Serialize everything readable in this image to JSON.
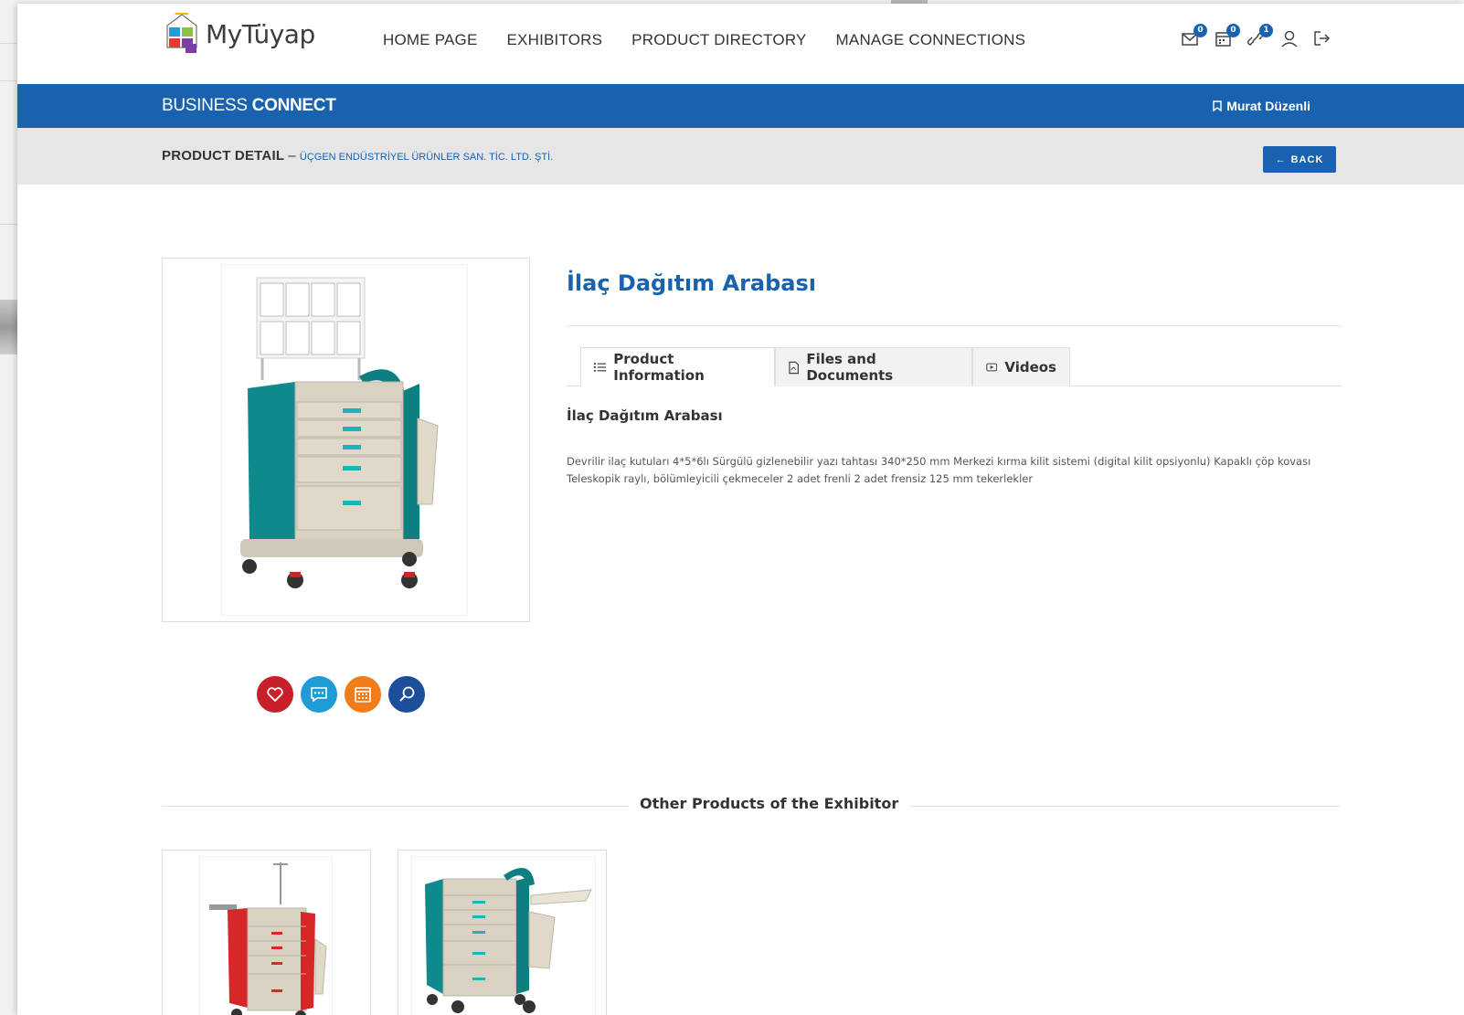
{
  "nav": {
    "logo_text": "MyTüyap",
    "menu": [
      {
        "label": "HOME PAGE"
      },
      {
        "label": "EXHIBITORS"
      },
      {
        "label": "PRODUCT DIRECTORY"
      },
      {
        "label": "MANAGE CONNECTIONS"
      }
    ],
    "badges": {
      "messages": "0",
      "calendar": "0",
      "connections": "1"
    }
  },
  "business_bar": {
    "title_light": "BUSINESS ",
    "title_bold": "CONNECT",
    "user_name": "Murat Düzenli"
  },
  "detail_bar": {
    "label": "PRODUCT DETAIL",
    "separator": " – ",
    "company": "ÜÇGEN ENDÜSTRİYEL ÜRÜNLER SAN. TİC. LTD. ŞTİ.",
    "back_label": "BACK"
  },
  "product": {
    "title": "İlaç Dağıtım Arabası",
    "tabs": [
      {
        "label": "Product Information",
        "icon": "list-icon",
        "active": true
      },
      {
        "label": "Files and Documents",
        "icon": "pdf-file-icon",
        "active": false
      },
      {
        "label": "Videos",
        "icon": "video-icon",
        "active": false
      }
    ],
    "subheading": "İlaç Dağıtım Arabası",
    "description": "Devrilir ilaç kutuları 4*5*6lı Sürgülü gizlenebilir yazı tahtası 340*250 mm Merkezi kırma kilit sistemi (digital kilit opsiyonlu) Kapaklı çöp kovası Teleskopik raylı, bölümleyicili çekmeceler 2 adet frenli 2 adet frensiz 125 mm tekerlekler"
  },
  "actions": [
    {
      "icon": "heart-icon",
      "color": "#c8202a"
    },
    {
      "icon": "chat-icon",
      "color": "#1f9bd7"
    },
    {
      "icon": "calendar-icon",
      "color": "#f07d1a"
    },
    {
      "icon": "search-icon",
      "color": "#1d4e9a"
    }
  ],
  "other_products": {
    "title": "Other Products of the Exhibitor"
  },
  "colors": {
    "primary": "#1862b0",
    "teal": "#0f8a8c",
    "cream": "#d9d2c2"
  }
}
